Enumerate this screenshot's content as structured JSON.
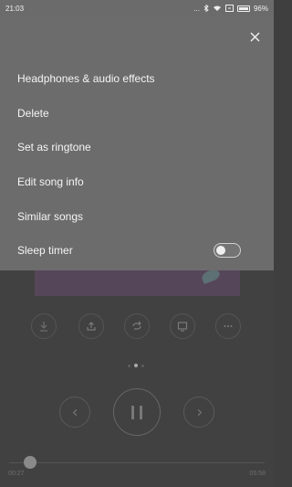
{
  "status_bar": {
    "time": "21:03",
    "signal_dots": "...",
    "battery_percent": "96%",
    "icons": [
      "bluetooth-icon",
      "wifi-icon",
      "battery-saver-icon"
    ]
  },
  "menu": {
    "items": [
      "Headphones & audio effects",
      "Delete",
      "Set as ringtone",
      "Edit song info",
      "Similar songs",
      "Sleep timer"
    ],
    "sleep_timer_on": false,
    "close_icon": "close-icon"
  },
  "player": {
    "actions": [
      "download-icon",
      "share-icon",
      "repeat-icon",
      "lyrics-icon",
      "more-icon"
    ],
    "page_indicator": {
      "count": 3,
      "active": 1
    },
    "controls": [
      "previous-icon",
      "pause-icon",
      "next-icon"
    ],
    "current_time": "00:27",
    "total_time": "05:58",
    "progress": 0.08
  },
  "colors": {
    "overlay": "#6c6c6c",
    "background": "#414141"
  }
}
